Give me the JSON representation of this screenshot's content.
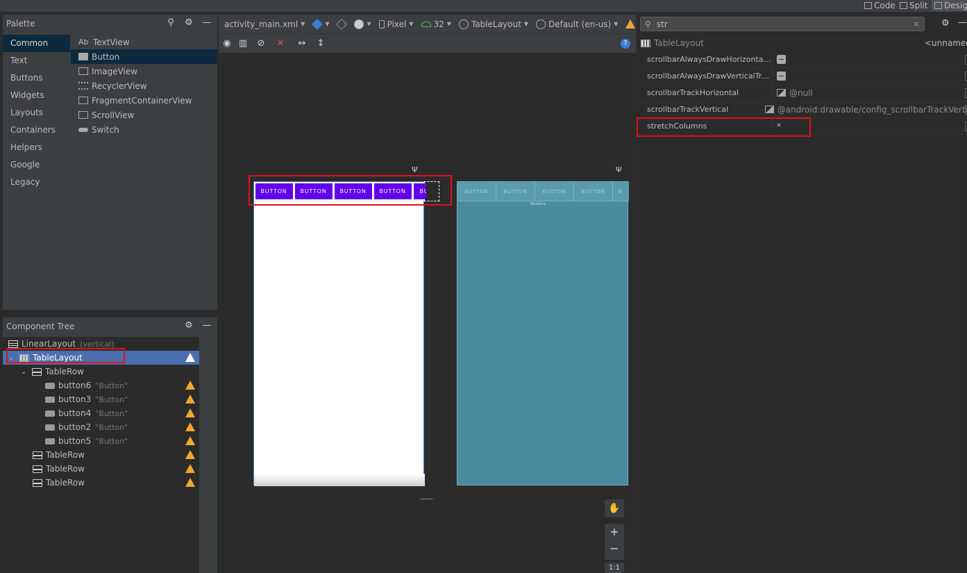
{
  "mode_bar": {
    "code": "Code",
    "split": "Split",
    "design": "Design"
  },
  "palette": {
    "title": "Palette",
    "categories": [
      "Common",
      "Text",
      "Buttons",
      "Widgets",
      "Layouts",
      "Containers",
      "Helpers",
      "Google",
      "Legacy"
    ],
    "selected_category": "Common",
    "items": [
      {
        "label": "TextView",
        "icon": "textview-icon"
      },
      {
        "label": "Button",
        "icon": "button-icon"
      },
      {
        "label": "ImageView",
        "icon": "image-icon"
      },
      {
        "label": "RecyclerView",
        "icon": "list-icon"
      },
      {
        "label": "FragmentContainerView",
        "icon": "fragment-icon"
      },
      {
        "label": "ScrollView",
        "icon": "scrollview-icon"
      },
      {
        "label": "Switch",
        "icon": "switch-icon"
      }
    ],
    "textview_icon_text": "Ab"
  },
  "component_tree": {
    "title": "Component Tree",
    "rows": [
      {
        "label": "LinearLayout",
        "hint": "(vertical)"
      },
      {
        "label": "TableLayout",
        "hint": ""
      },
      {
        "label": "TableRow",
        "hint": ""
      },
      {
        "label": "button6",
        "hint": "\"Button\""
      },
      {
        "label": "button3",
        "hint": "\"Button\""
      },
      {
        "label": "button4",
        "hint": "\"Button\""
      },
      {
        "label": "button2",
        "hint": "\"Button\""
      },
      {
        "label": "button5",
        "hint": "\"Button\""
      },
      {
        "label": "TableRow",
        "hint": ""
      },
      {
        "label": "TableRow",
        "hint": ""
      },
      {
        "label": "TableRow",
        "hint": ""
      }
    ]
  },
  "editor_toolbar": {
    "file": "activity_main.xml",
    "device": "Pixel",
    "api": "32",
    "layout": "TableLayout",
    "locale": "Default (en-us)"
  },
  "canvas": {
    "button_label": "BUTTON",
    "partial_label": "BU",
    "blueprint_partial": "B",
    "blueprint_caption": "TableRow",
    "zoom_plus": "+",
    "zoom_minus": "−",
    "zoom_reset": "1:1"
  },
  "attributes": {
    "search_value": "str",
    "component": "TableLayout",
    "id_value": "<unnamed>",
    "rows": [
      {
        "name": "scrollbarAlwaysDrawHorizontalTr...",
        "value": "",
        "kind": "bool"
      },
      {
        "name": "scrollbarAlwaysDrawVerticalTrack",
        "value": "",
        "kind": "bool"
      },
      {
        "name": "scrollbarTrackHorizontal",
        "value": "@null",
        "kind": "drawable"
      },
      {
        "name": "scrollbarTrackVertical",
        "value": "@android:drawable/config_scrollbarTrackVerti",
        "kind": "drawable"
      },
      {
        "name": "stretchColumns",
        "value": "*",
        "kind": "text"
      }
    ]
  },
  "colors": {
    "button_purple": "#6200ee",
    "highlight_red": "#e1121b",
    "blueprint": "#4b8a9f",
    "tree_selection": "#4b6eaf",
    "warning": "#f0a732"
  }
}
